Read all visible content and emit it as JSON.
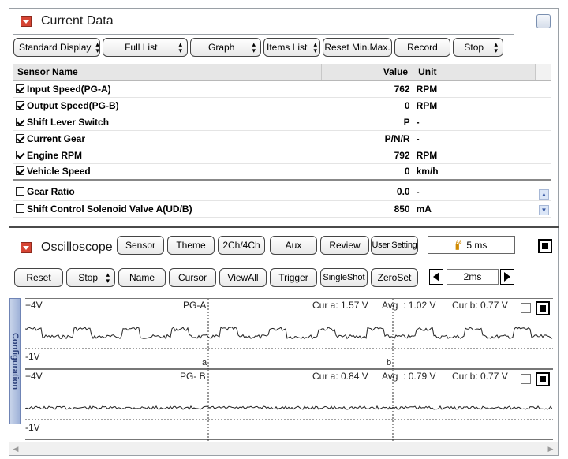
{
  "current_data": {
    "title": "Current Data",
    "toolbar": {
      "standard_display": "Standard Display",
      "full_list": "Full List",
      "graph": "Graph",
      "items_list": "Items List",
      "reset_minmax": "Reset Min.Max.",
      "record": "Record",
      "stop": "Stop"
    },
    "table": {
      "headers": {
        "name": "Sensor Name",
        "value": "Value",
        "unit": "Unit"
      },
      "rows": [
        {
          "name": "Input Speed(PG-A)",
          "value": "762",
          "unit": "RPM",
          "checked": true
        },
        {
          "name": "Output Speed(PG-B)",
          "value": "0",
          "unit": "RPM",
          "checked": true
        },
        {
          "name": "Shift Lever Switch",
          "value": "P",
          "unit": "-",
          "checked": true
        },
        {
          "name": "Current Gear",
          "value": "P/N/R",
          "unit": "-",
          "checked": true
        },
        {
          "name": "Engine RPM",
          "value": "792",
          "unit": "RPM",
          "checked": true
        },
        {
          "name": "Vehicle Speed",
          "value": "0",
          "unit": "km/h",
          "checked": true
        },
        {
          "name": "Gear Ratio",
          "value": "0.0",
          "unit": "-",
          "checked": false
        },
        {
          "name": "Shift Control Solenoid Valve A(UD/B)",
          "value": "850",
          "unit": "mA",
          "checked": false
        }
      ]
    }
  },
  "oscilloscope": {
    "title": "Oscilloscope",
    "toolbar1": {
      "sensor": "Sensor",
      "theme": "Theme",
      "channels": "2Ch/4Ch",
      "aux": "Aux",
      "review": "Review",
      "user_setting": "User Setting",
      "timebase": "5 ms"
    },
    "toolbar2": {
      "reset": "Reset",
      "stop": "Stop",
      "name": "Name",
      "cursor": "Cursor",
      "view_all": "ViewAll",
      "trigger": "Trigger",
      "single_shot": "SingleShot",
      "zero_set": "ZeroSet",
      "time_div": "2ms"
    },
    "side_tab": "Configuration",
    "channels": [
      {
        "top_label": "+4V",
        "name": "PG-A",
        "cur_a": "Cur a: 1.57 V",
        "avg": "Avg  : 1.02 V",
        "cur_b": "Cur b: 0.77 V",
        "bottom_label": "-1V",
        "marker_a": "a",
        "marker_b": "b"
      },
      {
        "top_label": "+4V",
        "name": "PG- B",
        "cur_a": "Cur a: 0.84 V",
        "avg": "Avg  : 0.79 V",
        "cur_b": "Cur b: 0.77 V",
        "bottom_label": "-1V"
      }
    ]
  }
}
